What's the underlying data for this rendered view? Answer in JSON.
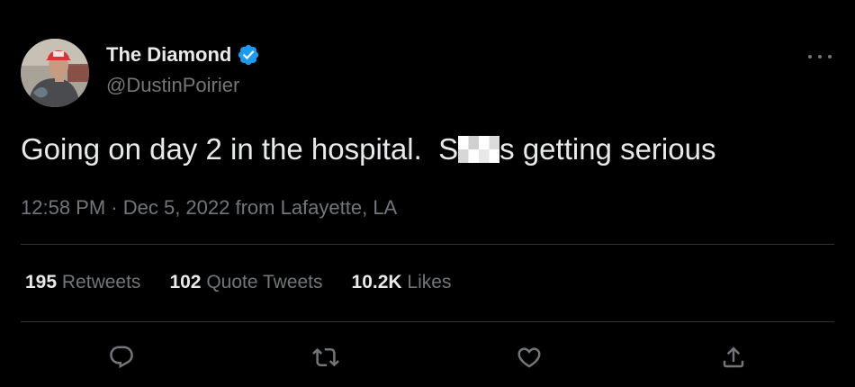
{
  "user": {
    "display_name": "The Diamond",
    "handle": "@DustinPoirier",
    "verified": true,
    "avatar_icon": "profile-photo"
  },
  "tweet": {
    "text_before": "Going on day 2 in the hospital.  S",
    "text_after": "s getting serious",
    "timestamp": "12:58 PM · Dec 5, 2022 from Lafayette, LA"
  },
  "stats": {
    "retweets_count": "195",
    "retweets_label": "Retweets",
    "quotes_count": "102",
    "quotes_label": "Quote Tweets",
    "likes_count": "10.2K",
    "likes_label": "Likes"
  },
  "icons": {
    "more": "more-horizontal-icon",
    "reply": "reply-icon",
    "retweet": "retweet-icon",
    "like": "heart-icon",
    "share": "share-icon"
  },
  "colors": {
    "background": "#000000",
    "text_primary": "#e7e9ea",
    "text_secondary": "#71767b",
    "verified_blue": "#1d9bf0",
    "divider": "#2f3336"
  }
}
